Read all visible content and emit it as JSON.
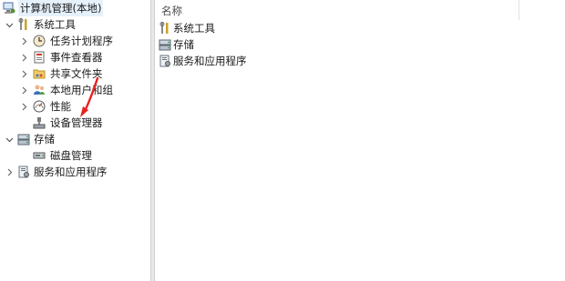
{
  "tree": {
    "root": {
      "label": "计算机管理(本地)"
    },
    "system_tools": {
      "label": "系统工具"
    },
    "task_scheduler": {
      "label": "任务计划程序"
    },
    "event_viewer": {
      "label": "事件查看器"
    },
    "shared_folders": {
      "label": "共享文件夹"
    },
    "local_users_groups": {
      "label": "本地用户和组"
    },
    "performance": {
      "label": "性能"
    },
    "device_manager": {
      "label": "设备管理器"
    },
    "storage": {
      "label": "存储"
    },
    "disk_management": {
      "label": "磁盘管理"
    },
    "services_apps": {
      "label": "服务和应用程序"
    }
  },
  "list": {
    "column_header": "名称",
    "items": [
      {
        "label": "系统工具",
        "icon": "tools-icon"
      },
      {
        "label": "存储",
        "icon": "storage-icon"
      },
      {
        "label": "服务和应用程序",
        "icon": "services-icon"
      }
    ]
  },
  "colors": {
    "annotation_arrow": "#e8231f",
    "selection": "#e5f1fb"
  }
}
